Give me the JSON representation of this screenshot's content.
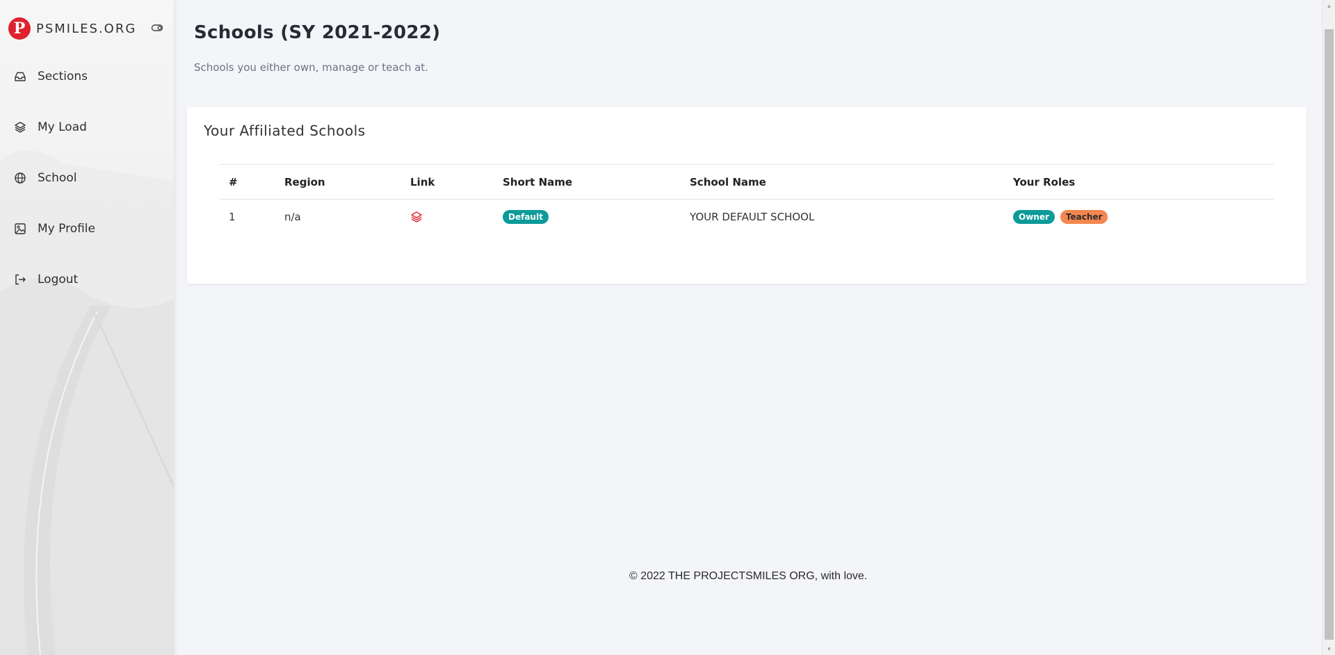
{
  "brand": {
    "logo_letter": "P",
    "name": "PSMILES.ORG"
  },
  "sidebar": {
    "items": [
      {
        "label": "Sections",
        "icon": "inbox-icon"
      },
      {
        "label": "My Load",
        "icon": "layers-icon"
      },
      {
        "label": "School",
        "icon": "globe-icon"
      },
      {
        "label": "My Profile",
        "icon": "image-icon"
      },
      {
        "label": "Logout",
        "icon": "logout-icon"
      }
    ]
  },
  "header": {
    "title": "Schools (SY 2021-2022)",
    "subtitle": "Schools you either own, manage or teach at."
  },
  "card": {
    "title": "Your Affiliated Schools",
    "columns": [
      "#",
      "Region",
      "Link",
      "Short Name",
      "School Name",
      "Your Roles"
    ],
    "rows": [
      {
        "num": "1",
        "region": "n/a",
        "link_icon": "layers-icon",
        "short_name": "Default",
        "school_name": "YOUR DEFAULT SCHOOL",
        "roles": [
          "Owner",
          "Teacher"
        ]
      }
    ]
  },
  "footer": {
    "text": "© 2022 THE PROJECTSMILES ORG, with love."
  },
  "colors": {
    "brand_red": "#e0202e",
    "badge_teal": "#0c9a9a",
    "badge_orange": "#f4874f",
    "link_icon_red": "#e0202e"
  }
}
